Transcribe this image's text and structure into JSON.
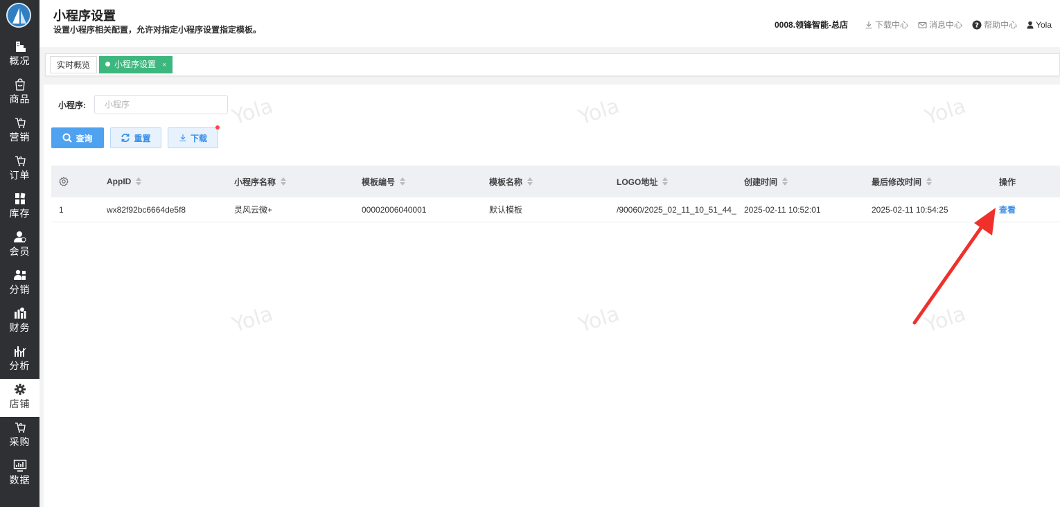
{
  "sidebar": {
    "items": [
      {
        "label": "概况",
        "icon": "building-icon"
      },
      {
        "label": "商品",
        "icon": "bag-icon"
      },
      {
        "label": "营销",
        "icon": "cart-icon"
      },
      {
        "label": "订单",
        "icon": "cart-icon"
      },
      {
        "label": "库存",
        "icon": "grid-icon"
      },
      {
        "label": "会员",
        "icon": "member-icon"
      },
      {
        "label": "分销",
        "icon": "distribution-icon"
      },
      {
        "label": "财务",
        "icon": "finance-icon"
      },
      {
        "label": "分析",
        "icon": "analysis-icon"
      },
      {
        "label": "店铺",
        "icon": "gear-icon",
        "active": true
      },
      {
        "label": "采购",
        "icon": "cart-icon"
      },
      {
        "label": "数据",
        "icon": "monitor-chart-icon"
      }
    ]
  },
  "header": {
    "title": "小程序设置",
    "subtitle": "设置小程序相关配置，允许对指定小程序设置指定模板。",
    "store": "0008.领锋智能-总店",
    "download_center": "下载中心",
    "message_center": "消息中心",
    "help_center": "帮助中心",
    "user": "Yola"
  },
  "tabs": {
    "overview": "实时概览",
    "current": "小程序设置",
    "close": "×"
  },
  "filter": {
    "label": "小程序:",
    "placeholder": "小程序"
  },
  "buttons": {
    "query": "查询",
    "reset": "重置",
    "download": "下载"
  },
  "table": {
    "columns": [
      "AppID",
      "小程序名称",
      "模板编号",
      "模板名称",
      "LOGO地址",
      "创建时间",
      "最后修改时间",
      "操作"
    ],
    "rows": [
      {
        "index": "1",
        "appid": "wx82f92bc6664de5f8",
        "name": "灵风云微+",
        "template_no": "00002006040001",
        "template_name": "默认模板",
        "logo": "/90060/2025_02_11_10_51_44_",
        "created": "2025-02-11 10:52:01",
        "modified": "2025-02-11 10:54:25",
        "action": "查看"
      }
    ]
  },
  "watermark": "Yola",
  "colors": {
    "sidebar_bg": "#2f3033",
    "tab_active": "#3cb77d",
    "primary": "#4fa2ef",
    "link": "#3a8ee6",
    "arrow": "#f0312b"
  }
}
